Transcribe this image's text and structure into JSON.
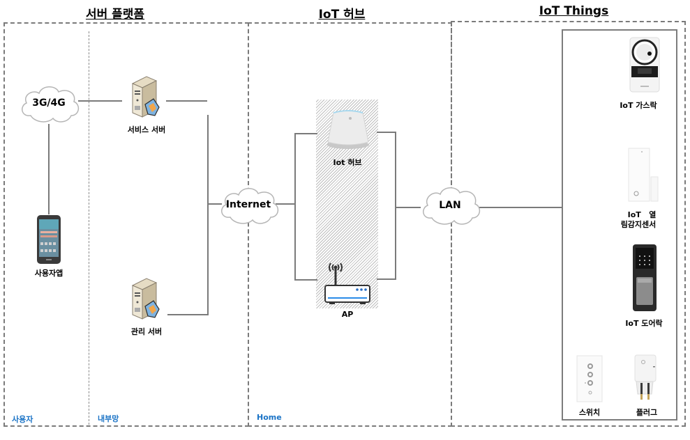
{
  "sections": {
    "server_platform": "서버 플랫폼",
    "iot_hub": "IoT 허브",
    "iot_things": "IoT Things"
  },
  "zones": {
    "user": "사용자",
    "internal": "내부망",
    "home": "Home"
  },
  "networks": {
    "mobile": "3G/4G",
    "internet": "Internet",
    "lan": "LAN"
  },
  "nodes": {
    "user_app": "사용자앱",
    "service_server": "서비스 서버",
    "management_server": "관리 서버",
    "hub": "Iot 허브",
    "ap": "AP"
  },
  "devices": [
    {
      "label": "IoT 가스락",
      "icon": "gas-lock-icon"
    },
    {
      "label_line1": "IoT   열",
      "label_line2": "림감지센서",
      "icon": "door-sensor-icon"
    },
    {
      "label": "IoT 도어락",
      "icon": "door-lock-icon"
    },
    {
      "label": "스위치",
      "icon": "wall-switch-icon"
    },
    {
      "label": "플러그",
      "icon": "smart-plug-icon"
    }
  ],
  "colors": {
    "zone_label": "#1a73c6",
    "line": "#7a7a7a",
    "ap_accent": "#2a8be8"
  }
}
